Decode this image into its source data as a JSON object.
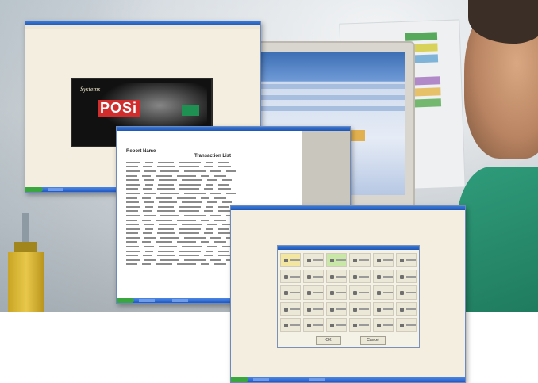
{
  "scene": {
    "window1": {
      "kind": "splash",
      "logo_text": "POSi",
      "logo_tagline": "Systems"
    },
    "window2": {
      "kind": "report",
      "title": "Report Name",
      "subtitle": "Transaction List"
    },
    "window3": {
      "kind": "button-grid",
      "ok_label": "OK",
      "cancel_label": "Cancel"
    }
  },
  "colors": {
    "titlebar": "#1f55b3",
    "taskbar": "#2258c4",
    "start": "#3aa640",
    "window_bg": "#f3eee0",
    "logo_accent": "#d12d2d"
  }
}
